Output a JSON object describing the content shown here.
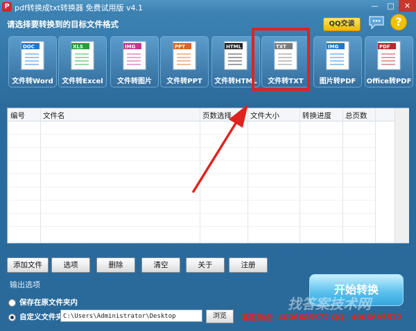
{
  "window": {
    "title": "pdf转换成txt转换器 免费试用版 v4.1",
    "app_icon": "P",
    "minimize": "—",
    "maximize": "□",
    "close": "✕"
  },
  "header": {
    "prompt": "请选择要转换到的目标文件格式",
    "qq_button": "QQ交谈",
    "help_icon": "?"
  },
  "formats": [
    {
      "label": "文件转Word",
      "tag": "DOC",
      "color": "#2b74c7"
    },
    {
      "label": "文件转Excel",
      "tag": "XLS",
      "color": "#2e9a3b"
    },
    {
      "label": "文件转图片",
      "tag": "IMG",
      "color": "#c23a8e"
    },
    {
      "label": "文件转PPT",
      "tag": "PPT",
      "color": "#e0641b"
    },
    {
      "label": "文件转HTML",
      "tag": "HTML",
      "color": "#222222"
    },
    {
      "label": "文件转TXT",
      "tag": "TXT",
      "color": "#7c7c7c"
    },
    {
      "label": "图片转PDF",
      "tag": "IMG",
      "color": "#2b74c7"
    },
    {
      "label": "Office转PDF",
      "tag": "PDF",
      "color": "#b8282c"
    }
  ],
  "selected_format_index": 5,
  "table": {
    "columns": [
      "编号",
      "文件名",
      "页数选择",
      "文件大小",
      "转换进度",
      "总页数"
    ],
    "rows": []
  },
  "toolbar": {
    "add": "添加文件",
    "options": "选项",
    "delete": "删除",
    "clear": "清空",
    "about": "关于",
    "register": "注册"
  },
  "output": {
    "title": "输出选项",
    "option_original": "保存在原文件夹内",
    "option_custom": "自定义文件夹",
    "selected": "custom",
    "path": "C:\\Users\\Administrator\\Desktop",
    "browse": "浏览"
  },
  "start_button": "开始转换",
  "hotline": "客服热线：4006685572  QQ：4006685572",
  "watermark": "找答案技术网"
}
